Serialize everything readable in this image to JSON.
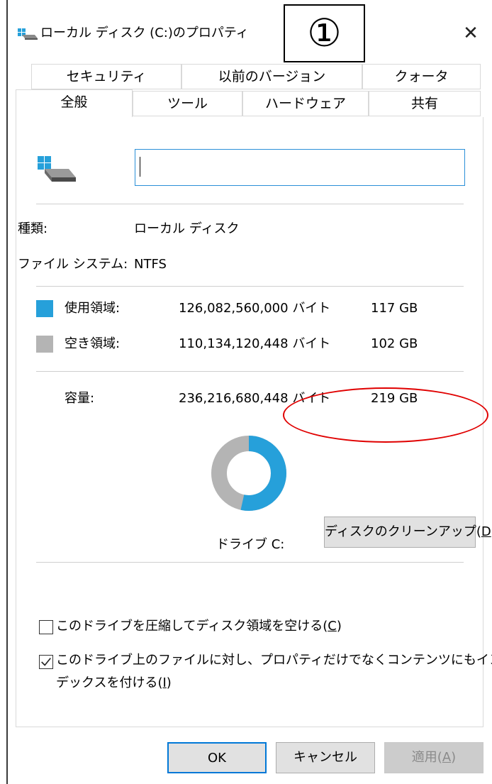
{
  "titlebar": {
    "title": "ローカル ディスク (C:)のプロパティ",
    "close": "✕"
  },
  "callout": {
    "marker": "①"
  },
  "tabs": {
    "row1": [
      "セキュリティ",
      "以前のバージョン",
      "クォータ"
    ],
    "row2": [
      "全般",
      "ツール",
      "ハードウェア",
      "共有"
    ],
    "active": "全般"
  },
  "general": {
    "name_value": "",
    "type_label": "種類:",
    "type_value": "ローカル ディスク",
    "fs_label": "ファイル システム:",
    "fs_value": "NTFS",
    "used": {
      "label": "使用領域:",
      "bytes": "126,082,560,000 バイト",
      "size": "117 GB",
      "color": "#26a0da"
    },
    "free": {
      "label": "空き領域:",
      "bytes": "110,134,120,448 バイト",
      "size": "102 GB",
      "color": "#b4b4b4"
    },
    "capacity": {
      "label": "容量:",
      "bytes": "236,216,680,448 バイト",
      "size": "219 GB"
    },
    "donut_used_fraction": 0.534,
    "drive_label": "ドライブ C:",
    "cleanup_button": {
      "text": "ディスクのクリーンアップ(",
      "key": "D",
      "close": ")"
    },
    "compress": {
      "text": "このドライブを圧縮してディスク領域を空ける(",
      "key": "C",
      "close": ")",
      "checked": false
    },
    "index": {
      "line1": "このドライブ上のファイルに対し、プロパティだけでなくコンテンツにもイン",
      "line2": "デックスを付ける(",
      "key": "I",
      "close": ")",
      "checked": true
    }
  },
  "buttons": {
    "ok": "OK",
    "cancel": "キャンセル",
    "apply": {
      "text": "適用(",
      "key": "A",
      "close": ")"
    }
  },
  "colors": {
    "accent": "#0078d7",
    "annotation": "#e00000"
  }
}
